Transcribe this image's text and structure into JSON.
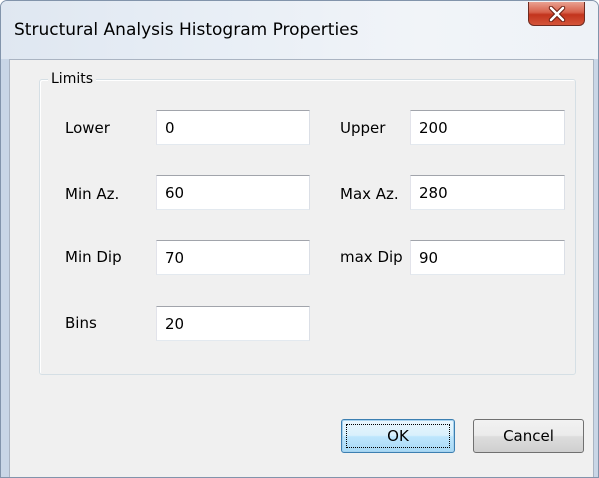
{
  "window": {
    "title": "Structural Analysis Histogram Properties"
  },
  "icons": {
    "close": "close-x-icon"
  },
  "colors": {
    "close_button": "#c9462d",
    "dialog_background": "#f0f0f0",
    "default_button_border": "#3c7fb1"
  },
  "limits": {
    "group_label": "Limits",
    "lower": {
      "label": "Lower",
      "value": "0"
    },
    "upper": {
      "label": "Upper",
      "value": "200"
    },
    "min_az": {
      "label": "Min Az.",
      "value": "60"
    },
    "max_az": {
      "label": "Max Az.",
      "value": "280"
    },
    "min_dip": {
      "label": "Min Dip",
      "value": "70"
    },
    "max_dip": {
      "label": "max Dip",
      "value": "90"
    },
    "bins": {
      "label": "Bins",
      "value": "20"
    }
  },
  "buttons": {
    "ok": "OK",
    "cancel": "Cancel"
  }
}
